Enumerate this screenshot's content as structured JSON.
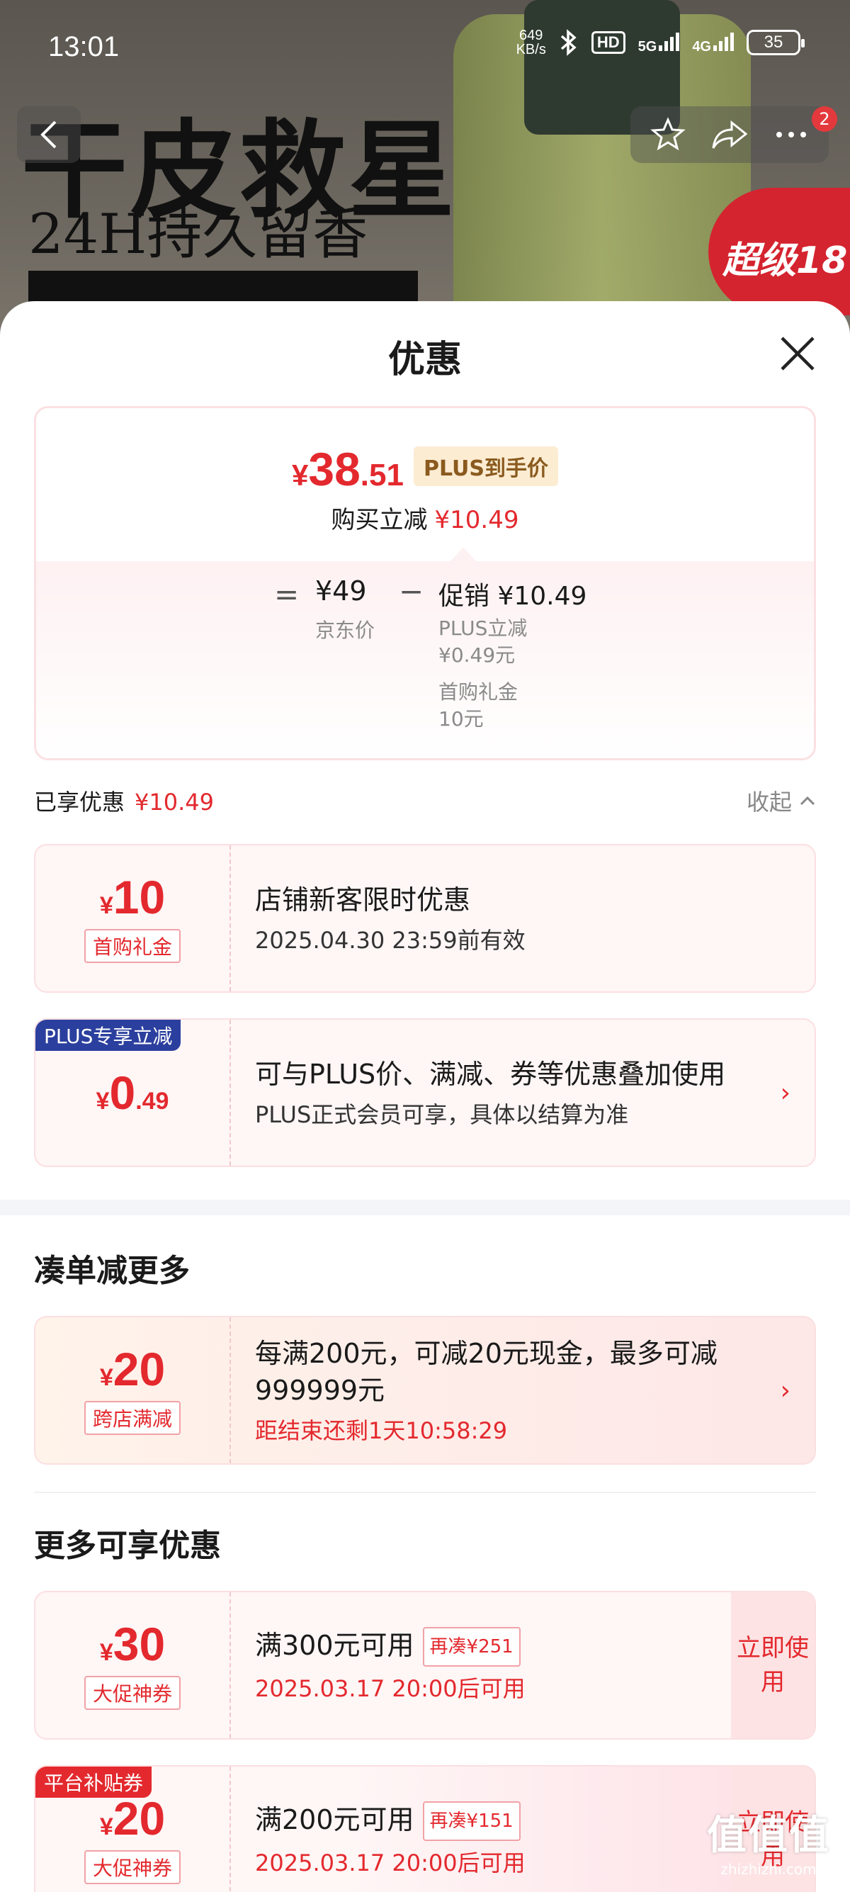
{
  "status_bar": {
    "time": "13:01",
    "net_speed_value": "649",
    "net_speed_unit": "KB/s",
    "hd": "HD",
    "sig1": "5G",
    "sig2": "4G",
    "battery": "35"
  },
  "background": {
    "promo_line1": "干皮救星",
    "promo_line2": "24H持久留香",
    "super_badge": "超级18",
    "notification_count": "2"
  },
  "sheet": {
    "title": "优惠",
    "price": {
      "currency": "¥",
      "integer": "38",
      "decimal": ".51",
      "plus_tag": "PLUS到手价",
      "reduce_label": "购买立减",
      "reduce_value": "¥10.49"
    },
    "breakdown": {
      "equals": "=",
      "jd_price": "¥49",
      "jd_label": "京东价",
      "minus": "−",
      "promo_label": "促销 ¥10.49",
      "detail1_label": "PLUS立减",
      "detail1_value": "¥0.49元",
      "detail2_label": "首购礼金",
      "detail2_value": "10元"
    },
    "enjoyed": {
      "label": "已享优惠",
      "value": "¥10.49",
      "collapse": "收起"
    },
    "cards": [
      {
        "currency": "¥",
        "integer": "10",
        "decimal": "",
        "tag": "首购礼金",
        "title": "店铺新客限时优惠",
        "sub": "2025.04.30 23:59前有效"
      },
      {
        "corner": "PLUS专享立减",
        "currency": "¥",
        "integer": "0",
        "decimal": ".49",
        "title": "可与PLUS价、满减、券等优惠叠加使用",
        "sub": "PLUS正式会员可享，具体以结算为准"
      }
    ],
    "section_more": "凑单减更多",
    "cross_store": {
      "currency": "¥",
      "integer": "20",
      "tag": "跨店满减",
      "title": "每满200元，可减20元现金，最多可减999999元",
      "countdown": "距结束还剩1天10:58:29"
    },
    "section_available": "更多可享优惠",
    "coupons": [
      {
        "currency": "¥",
        "integer": "30",
        "tag": "大促神券",
        "title": "满300元可用",
        "extra": "再凑¥251",
        "time": "2025.03.17 20:00后可用",
        "button": "立即使用"
      },
      {
        "corner": "平台补贴券",
        "currency": "¥",
        "integer": "20",
        "tag": "大促神券",
        "title": "满200元可用",
        "extra": "再凑¥151",
        "time": "2025.03.17 20:00后可用",
        "button": "立即使用"
      }
    ],
    "watermark": {
      "big": "值值值",
      "small": "zhizhizhi.com"
    }
  },
  "colors": {
    "accent_red": "#e3292e",
    "plus_blue": "#2b3f9e",
    "card_bg": "#fff6f6"
  }
}
